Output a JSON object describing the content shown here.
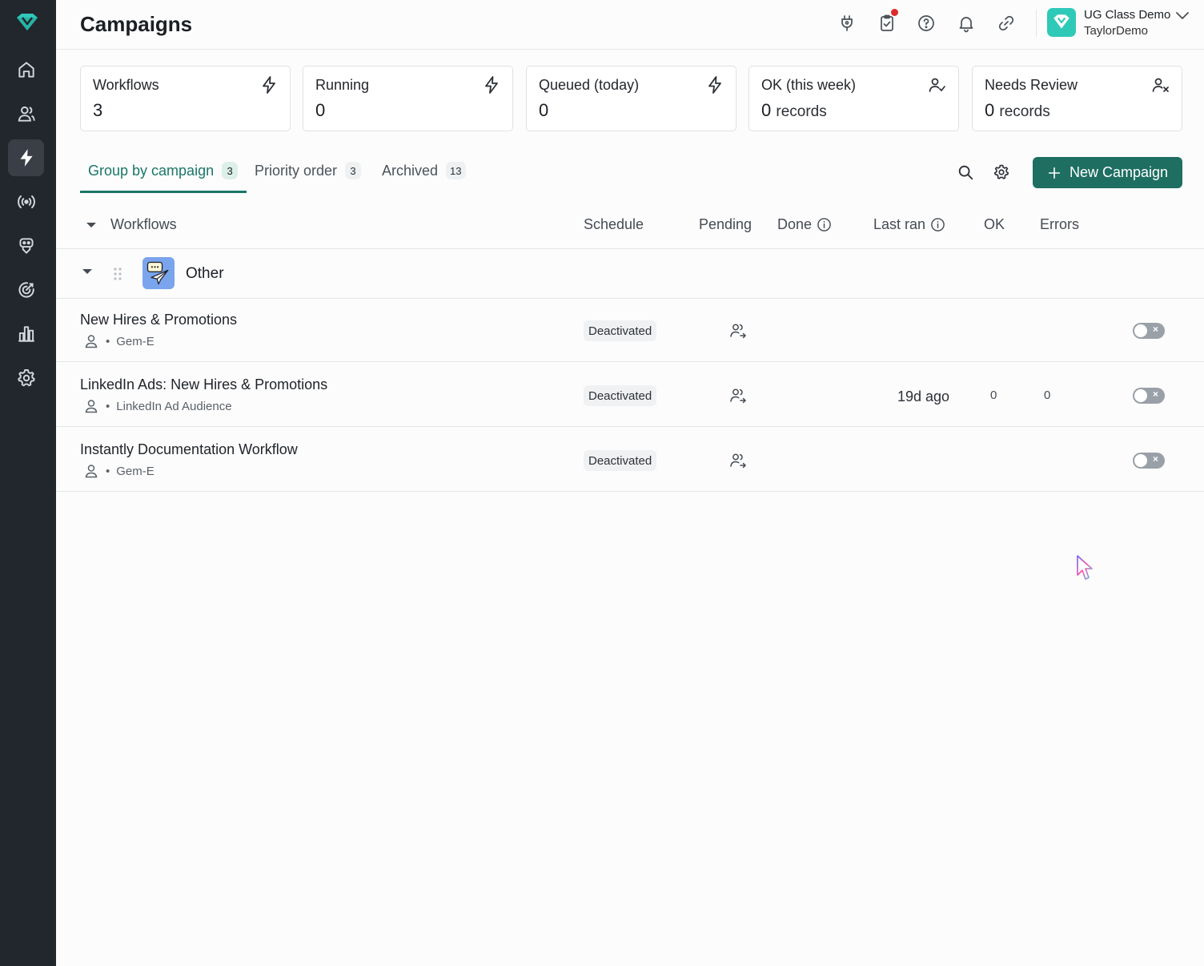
{
  "header": {
    "title": "Campaigns",
    "org_name": "UG Class Demo",
    "org_user": "TaylorDemo"
  },
  "stats": [
    {
      "label": "Workflows",
      "value": "3",
      "unit": "",
      "icon": "lightning-icon"
    },
    {
      "label": "Running",
      "value": "0",
      "unit": "",
      "icon": "lightning-icon"
    },
    {
      "label": "Queued (today)",
      "value": "0",
      "unit": "",
      "icon": "lightning-icon"
    },
    {
      "label": "OK (this week)",
      "value": "0",
      "unit": "records",
      "icon": "user-check-icon"
    },
    {
      "label": "Needs Review",
      "value": "0",
      "unit": "records",
      "icon": "user-x-icon"
    }
  ],
  "tabs": [
    {
      "label": "Group by campaign",
      "count": "3",
      "active": true
    },
    {
      "label": "Priority order",
      "count": "3",
      "active": false
    },
    {
      "label": "Archived",
      "count": "13",
      "active": false
    }
  ],
  "toolbar": {
    "new_campaign_label": "New Campaign"
  },
  "table": {
    "columns": {
      "workflows": "Workflows",
      "schedule": "Schedule",
      "pending": "Pending",
      "done": "Done",
      "last_ran": "Last ran",
      "ok": "OK",
      "errors": "Errors"
    },
    "group": {
      "name": "Other"
    },
    "rows": [
      {
        "title": "New Hires & Promotions",
        "source": "Gem-E",
        "status": "Deactivated",
        "last_ran": "",
        "ok": "",
        "errors": ""
      },
      {
        "title": "LinkedIn Ads: New Hires & Promotions",
        "source": "LinkedIn Ad Audience",
        "status": "Deactivated",
        "last_ran": "19d ago",
        "ok": "0",
        "errors": "0"
      },
      {
        "title": "Instantly Documentation Workflow",
        "source": "Gem-E",
        "status": "Deactivated",
        "last_ran": "",
        "ok": "",
        "errors": ""
      }
    ]
  },
  "colors": {
    "sidebar_bg": "#22262d",
    "accent": "#1a7767",
    "button_bg": "#1e6e62",
    "brand_teal": "#2fc9b8",
    "notification": "#dc2b2b"
  }
}
